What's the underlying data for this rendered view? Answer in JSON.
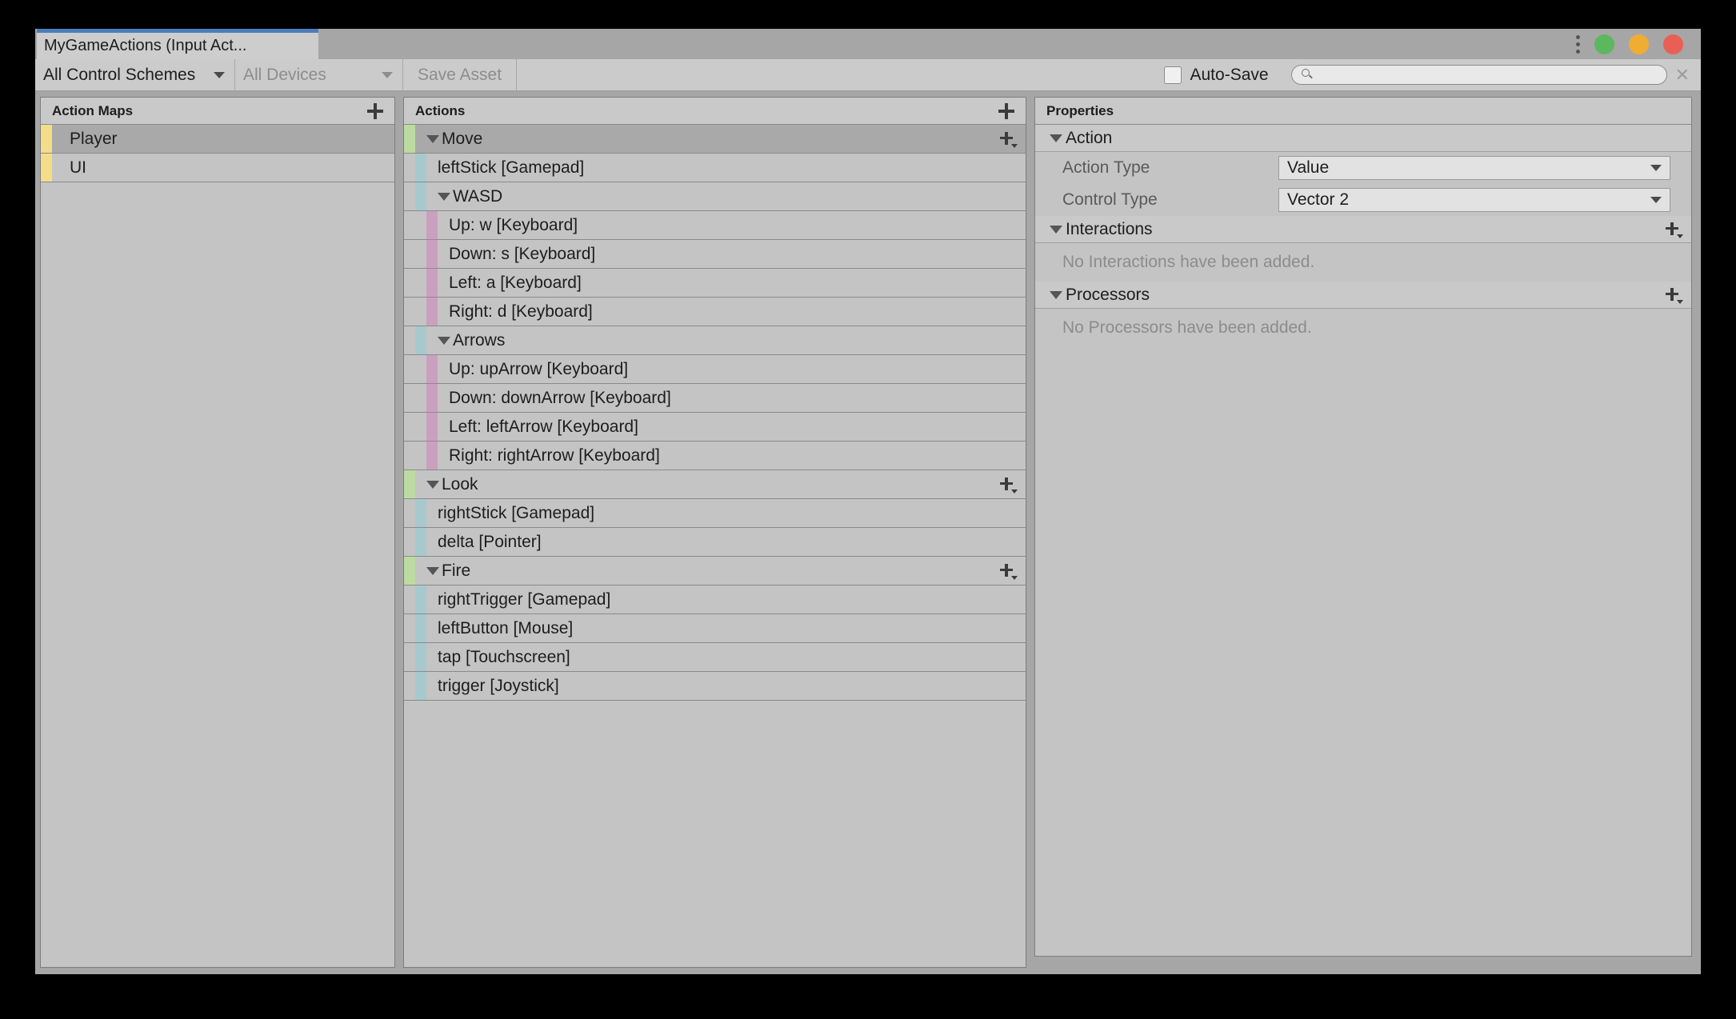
{
  "window": {
    "tab_title": "MyGameActions (Input Act...",
    "controls": {
      "menu_icon": "kebab-menu-icon",
      "minimize": "green-dot",
      "maximize": "yellow-dot",
      "close": "red-dot"
    }
  },
  "toolbar": {
    "control_schemes_label": "All Control Schemes",
    "devices_label": "All Devices",
    "save_asset_label": "Save Asset",
    "autosave_label": "Auto-Save",
    "autosave_checked": false,
    "search_value": "",
    "search_placeholder": "",
    "search_clear_label": "✕"
  },
  "action_maps": {
    "header": "Action Maps",
    "add_label": "+",
    "strip_color": "#f3dd8a",
    "items": [
      {
        "label": "Player",
        "selected": true
      },
      {
        "label": "UI",
        "selected": false
      }
    ]
  },
  "actions": {
    "header": "Actions",
    "add_label": "+",
    "colors": {
      "action": "#bcdba2",
      "binding": "#a7c9cd",
      "composite": "#c9a1bf"
    },
    "rows": [
      {
        "label": "Move",
        "kind": "action",
        "level": 1,
        "expanded": true,
        "selected": true,
        "has_add": true
      },
      {
        "label": "leftStick [Gamepad]",
        "kind": "binding",
        "level": 2,
        "expanded": false,
        "selected": false,
        "has_add": false
      },
      {
        "label": "WASD",
        "kind": "binding",
        "level": 2,
        "expanded": true,
        "selected": false,
        "has_add": false
      },
      {
        "label": "Up: w [Keyboard]",
        "kind": "composite",
        "level": 3,
        "expanded": false,
        "selected": false,
        "has_add": false
      },
      {
        "label": "Down: s [Keyboard]",
        "kind": "composite",
        "level": 3,
        "expanded": false,
        "selected": false,
        "has_add": false
      },
      {
        "label": "Left: a [Keyboard]",
        "kind": "composite",
        "level": 3,
        "expanded": false,
        "selected": false,
        "has_add": false
      },
      {
        "label": "Right: d [Keyboard]",
        "kind": "composite",
        "level": 3,
        "expanded": false,
        "selected": false,
        "has_add": false
      },
      {
        "label": "Arrows",
        "kind": "binding",
        "level": 2,
        "expanded": true,
        "selected": false,
        "has_add": false
      },
      {
        "label": "Up: upArrow [Keyboard]",
        "kind": "composite",
        "level": 3,
        "expanded": false,
        "selected": false,
        "has_add": false
      },
      {
        "label": "Down: downArrow [Keyboard]",
        "kind": "composite",
        "level": 3,
        "expanded": false,
        "selected": false,
        "has_add": false
      },
      {
        "label": "Left: leftArrow [Keyboard]",
        "kind": "composite",
        "level": 3,
        "expanded": false,
        "selected": false,
        "has_add": false
      },
      {
        "label": "Right: rightArrow [Keyboard]",
        "kind": "composite",
        "level": 3,
        "expanded": false,
        "selected": false,
        "has_add": false
      },
      {
        "label": "Look",
        "kind": "action",
        "level": 1,
        "expanded": true,
        "selected": false,
        "has_add": true
      },
      {
        "label": "rightStick [Gamepad]",
        "kind": "binding",
        "level": 2,
        "expanded": false,
        "selected": false,
        "has_add": false
      },
      {
        "label": "delta [Pointer]",
        "kind": "binding",
        "level": 2,
        "expanded": false,
        "selected": false,
        "has_add": false
      },
      {
        "label": "Fire",
        "kind": "action",
        "level": 1,
        "expanded": true,
        "selected": false,
        "has_add": true
      },
      {
        "label": "rightTrigger [Gamepad]",
        "kind": "binding",
        "level": 2,
        "expanded": false,
        "selected": false,
        "has_add": false
      },
      {
        "label": "leftButton [Mouse]",
        "kind": "binding",
        "level": 2,
        "expanded": false,
        "selected": false,
        "has_add": false
      },
      {
        "label": "tap [Touchscreen]",
        "kind": "binding",
        "level": 2,
        "expanded": false,
        "selected": false,
        "has_add": false
      },
      {
        "label": "trigger [Joystick]",
        "kind": "binding",
        "level": 2,
        "expanded": false,
        "selected": false,
        "has_add": false
      }
    ]
  },
  "properties": {
    "header": "Properties",
    "action_section": {
      "label": "Action",
      "fields": [
        {
          "name": "Action Type",
          "value": "Value"
        },
        {
          "name": "Control Type",
          "value": "Vector 2"
        }
      ]
    },
    "interactions_section": {
      "label": "Interactions",
      "empty_text": "No Interactions have been added."
    },
    "processors_section": {
      "label": "Processors",
      "empty_text": "No Processors have been added."
    }
  }
}
